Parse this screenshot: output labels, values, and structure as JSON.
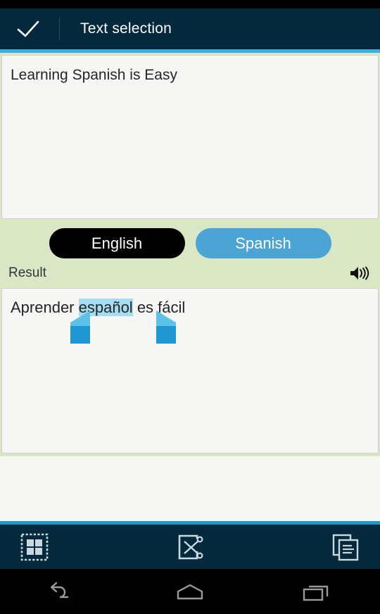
{
  "header": {
    "confirm_icon": "check-icon",
    "title": "Text selection"
  },
  "source": {
    "text": "Learning Spanish is Easy"
  },
  "languages": {
    "source_label": "English",
    "target_label": "Spanish"
  },
  "result": {
    "label": "Result",
    "speaker_icon": "speaker-icon",
    "text_before": "Aprender ",
    "selected_text": "español",
    "text_after": " es fácil"
  },
  "action_bar": {
    "select_all_icon": "select-all-icon",
    "cut_icon": "cut-icon",
    "copy_icon": "copy-icon"
  },
  "nav_bar": {
    "back_icon": "back-icon",
    "home_icon": "home-icon",
    "recents_icon": "recents-icon"
  },
  "colors": {
    "header_bg": "#04293c",
    "accent": "#3aaede",
    "panel_green": "#dae7c4",
    "target_lang_bg": "#4ba4d3",
    "selection_highlight": "#a6dcf0",
    "handle_blue": "#2196d3"
  }
}
